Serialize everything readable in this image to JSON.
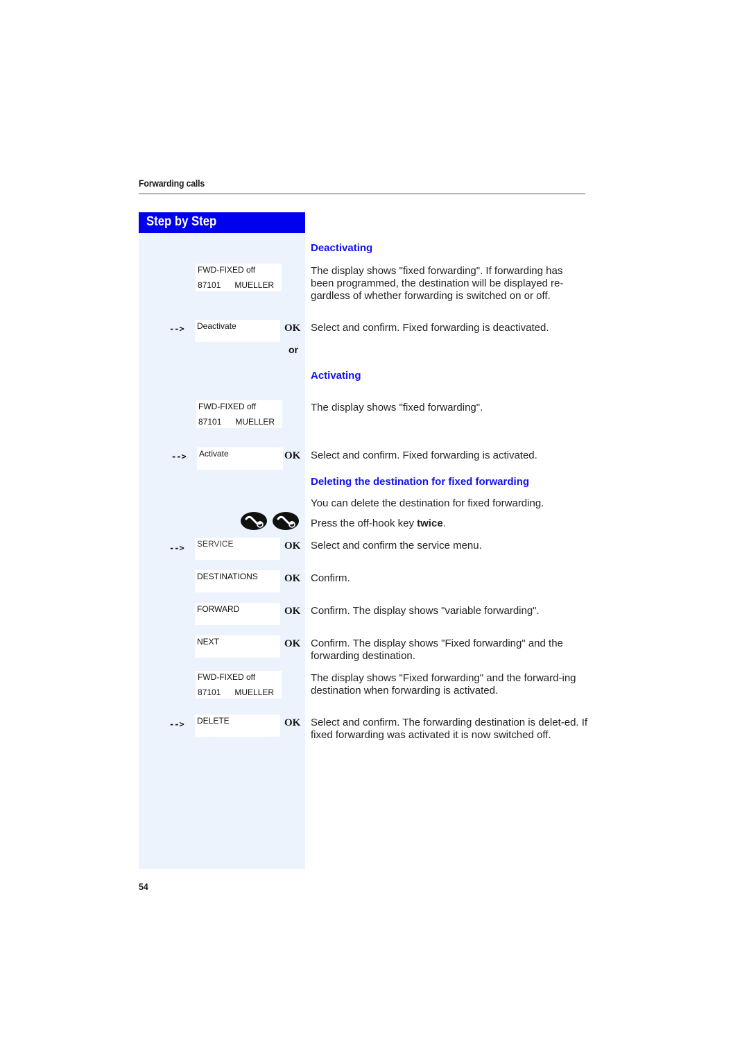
{
  "header": {
    "title": "Forwarding calls"
  },
  "sidebar": {
    "title": "Step by Step"
  },
  "page_number": "54",
  "symbols": {
    "arrow": "-->",
    "ok": "OK",
    "or": "or"
  },
  "sections": {
    "deactivating": {
      "heading": "Deactivating",
      "display": {
        "line1": "FWD-FIXED off",
        "line2": "87101      MUELLER"
      },
      "display_text": "The display shows \"fixed forwarding\". If forwarding has been programmed, the destination will be displayed re-gardless of whether forwarding is switched on or off.",
      "option": "Deactivate",
      "option_text": "Select and confirm. Fixed forwarding is deactivated."
    },
    "activating": {
      "heading": "Activating",
      "display": {
        "line1": "FWD-FIXED off",
        "line2": "87101      MUELLER"
      },
      "display_text": "The display shows \"fixed forwarding\".",
      "option": "Activate",
      "option_text": "Select and confirm. Fixed forwarding is activated."
    },
    "deleting": {
      "heading": "Deleting the destination for fixed forwarding",
      "intro": "You can delete the destination for fixed forwarding.",
      "offhook_text_prefix": "Press the off-hook key ",
      "offhook_text_bold": "twice",
      "offhook_text_suffix": ".",
      "steps": [
        {
          "option": "SERVICE",
          "text": "Select and confirm the service menu."
        },
        {
          "option": "DESTINATIONS",
          "text": "Confirm."
        },
        {
          "option": "FORWARD",
          "text": "Confirm. The display shows \"variable forwarding\"."
        },
        {
          "option": "NEXT",
          "text": "Confirm. The display shows \"Fixed forwarding\" and the forwarding destination."
        }
      ],
      "display": {
        "line1": "FWD-FIXED off",
        "line2": "87101      MUELLER"
      },
      "display_text": "The display shows \"Fixed forwarding\" and the forward-ing destination when forwarding is activated.",
      "delete_option": "DELETE",
      "delete_text": "Select and confirm. The forwarding destination is delet-ed. If fixed forwarding was activated it is now switched off."
    }
  }
}
